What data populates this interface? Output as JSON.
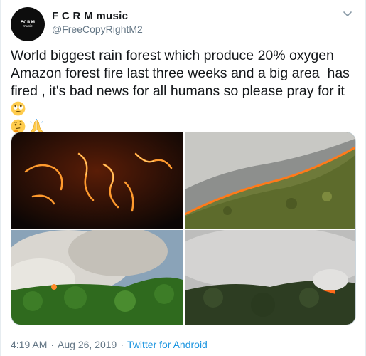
{
  "author": {
    "name": "F C R M music",
    "handle": "@FreeCopyRightM2",
    "avatar_line1": "FCRM",
    "avatar_line2": "music"
  },
  "tweet": {
    "text": "World biggest rain forest which produce 20% oxygen Amazon forest fire last three weeks and a big area  has fired , it's bad news for all humans so please pray for it ",
    "emojis": [
      "face-with-rolling-eyes-icon",
      "thinking-face-icon",
      "folded-hands-icon"
    ]
  },
  "media": {
    "count": 4,
    "images": [
      "night-forest-fire-image",
      "aerial-fire-line-image",
      "smoke-over-jungle-image",
      "burning-forest-smoke-image"
    ]
  },
  "meta": {
    "time": "4:19 AM",
    "date": "Aug 26, 2019",
    "separator": "·",
    "source": "Twitter for Android"
  },
  "colors": {
    "text": "#14171a",
    "secondary": "#657786",
    "link": "#1b95e0"
  }
}
